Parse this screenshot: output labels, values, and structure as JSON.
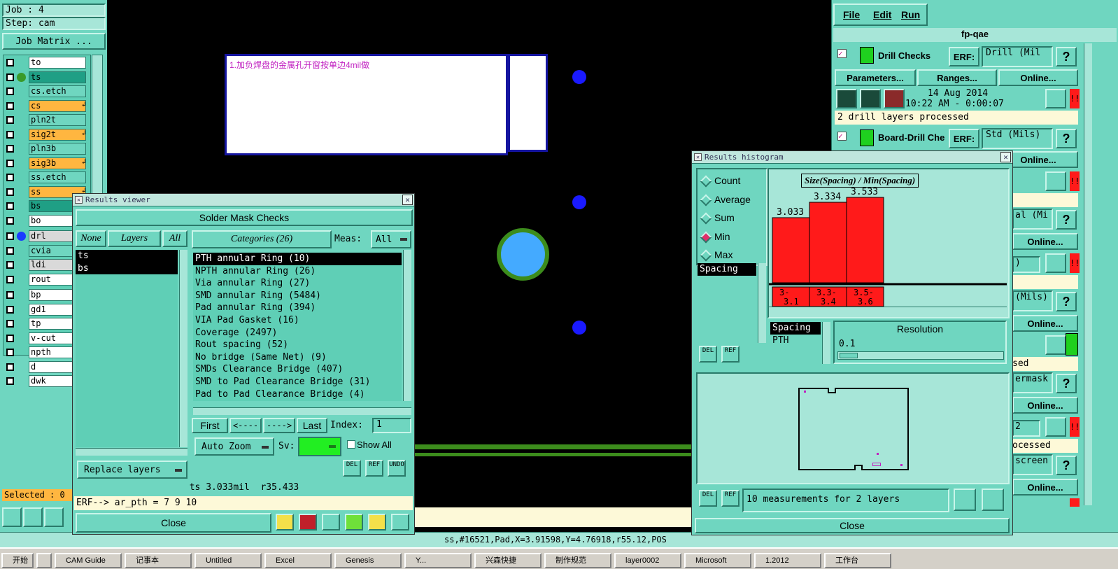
{
  "left_panel": {
    "job": "Job : 4",
    "step": "Step: cam",
    "job_matrix": "Job Matrix ...",
    "layers": [
      {
        "name": "to",
        "bg": "#ffffff",
        "dot": "",
        "mark": ""
      },
      {
        "name": "ts",
        "bg": "#1f9f85",
        "dot": "#3a9a2a",
        "mark": ""
      },
      {
        "name": "cs.etch",
        "bg": "#6fd6c0",
        "dot": "",
        "mark": ""
      },
      {
        "name": "cs",
        "bg": "#ffb640",
        "dot": "",
        "mark": "↲"
      },
      {
        "name": "pln2t",
        "bg": "#6fd6c0",
        "dot": "",
        "mark": ""
      },
      {
        "name": "sig2t",
        "bg": "#ffb640",
        "dot": "",
        "mark": "↲"
      },
      {
        "name": "pln3b",
        "bg": "#6fd6c0",
        "dot": "",
        "mark": ""
      },
      {
        "name": "sig3b",
        "bg": "#ffb640",
        "dot": "",
        "mark": "↲"
      },
      {
        "name": "ss.etch",
        "bg": "#6fd6c0",
        "dot": "",
        "mark": ""
      },
      {
        "name": "ss",
        "bg": "#ffb640",
        "dot": "",
        "mark": "↲"
      },
      {
        "name": "bs",
        "bg": "#1f9f85",
        "dot": "",
        "mark": ""
      },
      {
        "name": "bo",
        "bg": "#ffffff",
        "dot": "",
        "mark": ""
      },
      {
        "name": "drl",
        "bg": "#d9d9d9",
        "dot": "#1a3cff",
        "mark": ""
      },
      {
        "name": "cvia",
        "bg": "#6fd6c0",
        "dot": "",
        "mark": ""
      },
      {
        "name": "ldi",
        "bg": "#d9d9d9",
        "dot": "",
        "mark": ""
      },
      {
        "name": "rout",
        "bg": "#ffffff",
        "dot": "",
        "mark": ""
      },
      {
        "name": "bp",
        "bg": "#ffffff",
        "dot": "",
        "mark": ""
      },
      {
        "name": "gd1",
        "bg": "#ffffff",
        "dot": "",
        "mark": ""
      },
      {
        "name": "tp",
        "bg": "#ffffff",
        "dot": "",
        "mark": ""
      },
      {
        "name": "v-cut",
        "bg": "#ffffff",
        "dot": "",
        "mark": ""
      },
      {
        "name": "npth",
        "bg": "#ffffff",
        "dot": "",
        "mark": ""
      },
      {
        "name": "d",
        "bg": "#ffffff",
        "dot": "",
        "mark": ""
      },
      {
        "name": "dwk",
        "bg": "#ffffff",
        "dot": "",
        "mark": ""
      }
    ],
    "selected": "Selected : 0"
  },
  "canvas": {
    "note": "1.加负焊盘的金属孔开窗按单边4mil做"
  },
  "status_bar": "ss,#16521,Pad,X=3.91598,Y=4.76918,r55.12,POS",
  "results_viewer": {
    "title": "Results viewer",
    "header": "Solder Mask Checks",
    "none": "None",
    "layers": "Layers",
    "all": "All",
    "categories_btn": "Categories (26)",
    "meas_label": "Meas:",
    "meas_value": "All",
    "layer_items": [
      "ts",
      "bs"
    ],
    "categories": [
      "PTH annular Ring (10)",
      "NPTH annular Ring (26)",
      "Via annular Ring (27)",
      "SMD annular Ring (5484)",
      "Pad annular Ring (394)",
      "VIA Pad Gasket (16)",
      "Coverage (2497)",
      "Rout spacing (52)",
      "No bridge (Same Net) (9)",
      "SMDs Clearance Bridge (407)",
      "SMD to Pad Clearance Bridge (31)",
      "Pad to Pad Clearance Bridge (4)"
    ],
    "first": "First",
    "prev": "<----",
    "next": "---->",
    "last": "Last",
    "index_label": "Index:",
    "index_value": "1",
    "auto_zoom": "Auto Zoom",
    "sv": "Sv:",
    "show_all": "Show All",
    "replace_layers": "Replace layers",
    "del": "DEL",
    "ref": "REF",
    "undo": "UNDO",
    "status": "ts 3.033mil  r35.433",
    "erf": "ERF--> ar_pth = 7 9 10",
    "close": "Close"
  },
  "histogram": {
    "title": "Results histogram",
    "radios": [
      "Count",
      "Average",
      "Sum",
      "Min",
      "Max"
    ],
    "selected_radio": "Min",
    "chart_title": "Size(Spacing) / Min(Spacing)",
    "bars": [
      {
        "label": "3.033",
        "range": "3-\n3.1",
        "value": 3.033
      },
      {
        "label": "3.334",
        "range": "3.3-\n3.4",
        "value": 3.334
      },
      {
        "label": "3.533",
        "range": "3.5-\n3.6",
        "value": 3.533
      }
    ],
    "left_list": [
      "Spacing"
    ],
    "sub_list": [
      "Spacing",
      "PTH"
    ],
    "resolution_label": "Resolution",
    "resolution_value": "0.1",
    "measurements": "10 measurements for 2 layers",
    "del": "DEL",
    "ref": "REF",
    "close": "Close"
  },
  "right_panel": {
    "menu": [
      "File",
      "Edit",
      "Run"
    ],
    "title": "fp-qae",
    "checks": [
      {
        "name": "Drill Checks",
        "erf": "ERF:",
        "erf_value": "Drill (Mil",
        "params": "Parameters...",
        "ranges": "Ranges...",
        "online": "Online...",
        "date": "14 Aug 2014",
        "time": "10:22 AM - 0:00:07",
        "status": "2 drill layers processed"
      },
      {
        "name": "Board-Drill Che",
        "erf": "ERF:",
        "erf_value": "Std (Mils)",
        "online": "Online..."
      }
    ],
    "partial_rows": [
      {
        "erf_value": "al (Mi",
        "online": "Online...",
        "status": ""
      },
      {
        "erf_value": ")",
        "online": "",
        "status": ""
      },
      {
        "erf_value": "(Mils)",
        "online": "Online...",
        "status": ""
      },
      {
        "erf_value": "",
        "online": "",
        "status": "sed"
      },
      {
        "erf_value": "ermask",
        "online": "Online...",
        "status": ""
      },
      {
        "erf_value": "2",
        "online": "",
        "status": "ocessed"
      },
      {
        "erf_value": "screen",
        "online": "Online...",
        "status": ""
      }
    ],
    "help": "?"
  },
  "taskbar": {
    "items": [
      "开始",
      "",
      "CAM Guide",
      "记事本",
      "Untitled",
      "Excel",
      "Genesis",
      "Y...",
      "兴森快捷",
      "制作规范",
      "layer0002",
      "Microsoft",
      "1.2012",
      "工作台"
    ]
  }
}
